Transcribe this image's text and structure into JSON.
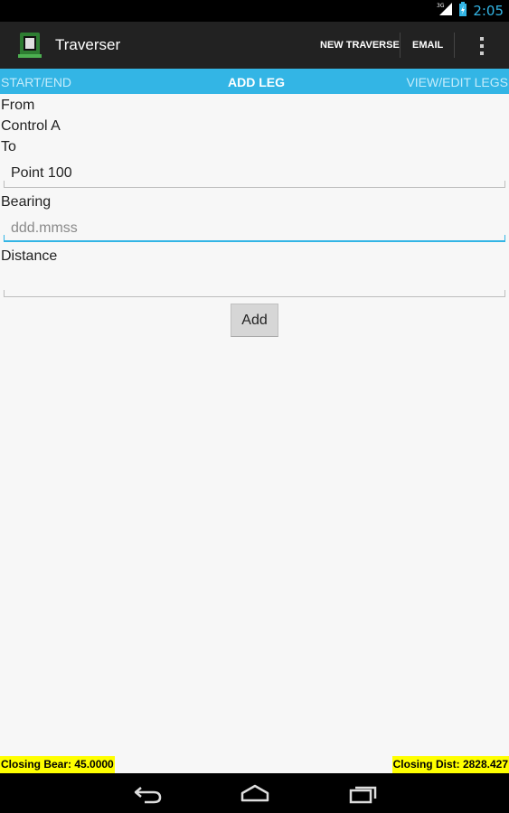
{
  "status_bar": {
    "network_label": "3G",
    "time": "2:05",
    "icons": [
      "signal-icon",
      "battery-icon"
    ]
  },
  "action_bar": {
    "title": "Traverser",
    "app_icon": "app-icon",
    "actions": {
      "new_traverse": "NEW TRAVERSE",
      "email": "EMAIL"
    },
    "overflow_icon": "overflow-menu-icon"
  },
  "tabs": {
    "start_end": "START/END",
    "add_leg": "ADD LEG",
    "view_edit_legs": "VIEW/EDIT LEGS",
    "active": "ADD LEG"
  },
  "form": {
    "from_label": "From",
    "from_value": "Control A",
    "to_label": "To",
    "to_value": "Point 100",
    "bearing_label": "Bearing",
    "bearing_value": "",
    "bearing_placeholder": "ddd.mmss",
    "distance_label": "Distance",
    "distance_value": "",
    "add_button": "Add"
  },
  "footer": {
    "closing_bearing": "Closing Bear: 45.0000",
    "closing_distance": "Closing Dist: 2828.427"
  },
  "nav_bar": {
    "icons": [
      "back-icon",
      "home-icon",
      "recent-apps-icon"
    ]
  },
  "colors": {
    "accent": "#33b5e5",
    "highlight": "#ffff00",
    "action_bar": "#222222",
    "background": "#f7f7f7"
  }
}
